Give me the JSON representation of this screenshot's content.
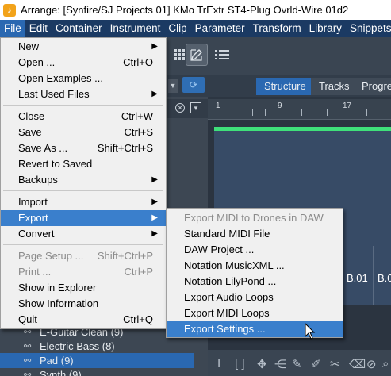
{
  "window": {
    "title": "Arrange: [Synfire/SJ Projects 01] KMo TrExtr ST4-Plug Ovrld-Wire 01d2",
    "app_icon": "synfire-app-icon"
  },
  "menubar": [
    "File",
    "Edit",
    "Container",
    "Instrument",
    "Clip",
    "Parameter",
    "Transform",
    "Library",
    "Snippets"
  ],
  "tabs": [
    "Structure",
    "Tracks",
    "Progres"
  ],
  "ruler": {
    "marks": [
      "1",
      "9",
      "17"
    ]
  },
  "clip_labels": [
    "B.01",
    "B.0"
  ],
  "tree": [
    {
      "label": "E-Guitar Clean (9)"
    },
    {
      "label": "Electric Bass (8)"
    },
    {
      "label": "Pad (9)"
    },
    {
      "label": "Synth (9)"
    }
  ],
  "file_menu": [
    {
      "label": "New",
      "shortcut": "",
      "submenu": true,
      "disabled": false
    },
    {
      "label": "Open ...",
      "shortcut": "Ctrl+O",
      "submenu": false,
      "disabled": false
    },
    {
      "label": "Open Examples ...",
      "shortcut": "",
      "submenu": false,
      "disabled": false
    },
    {
      "label": "Last Used Files",
      "shortcut": "",
      "submenu": true,
      "disabled": false
    },
    {
      "label": "Close",
      "shortcut": "Ctrl+W",
      "submenu": false,
      "disabled": false
    },
    {
      "label": "Save",
      "shortcut": "Ctrl+S",
      "submenu": false,
      "disabled": false
    },
    {
      "label": "Save As ...",
      "shortcut": "Shift+Ctrl+S",
      "submenu": false,
      "disabled": false
    },
    {
      "label": "Revert to Saved",
      "shortcut": "",
      "submenu": false,
      "disabled": false
    },
    {
      "label": "Backups",
      "shortcut": "",
      "submenu": true,
      "disabled": false
    },
    {
      "label": "Import",
      "shortcut": "",
      "submenu": true,
      "disabled": false
    },
    {
      "label": "Export",
      "shortcut": "",
      "submenu": true,
      "disabled": false
    },
    {
      "label": "Convert",
      "shortcut": "",
      "submenu": true,
      "disabled": false
    },
    {
      "label": "Page Setup ...",
      "shortcut": "Shift+Ctrl+P",
      "submenu": false,
      "disabled": true
    },
    {
      "label": "Print ...",
      "shortcut": "Ctrl+P",
      "submenu": false,
      "disabled": true
    },
    {
      "label": "Show in Explorer",
      "shortcut": "",
      "submenu": false,
      "disabled": false
    },
    {
      "label": "Show Information",
      "shortcut": "",
      "submenu": false,
      "disabled": false
    },
    {
      "label": "Quit",
      "shortcut": "Ctrl+Q",
      "submenu": false,
      "disabled": false
    }
  ],
  "export_menu": [
    {
      "label": "Export MIDI to Drones in DAW",
      "disabled": true
    },
    {
      "label": "Standard MIDI File",
      "disabled": false
    },
    {
      "label": "DAW Project ...",
      "disabled": false
    },
    {
      "label": "Notation MusicXML ...",
      "disabled": false
    },
    {
      "label": "Notation LilyPond ...",
      "disabled": false
    },
    {
      "label": "Export Audio Loops",
      "disabled": false
    },
    {
      "label": "Export MIDI Loops",
      "disabled": false
    },
    {
      "label": "Export Settings ...",
      "disabled": false
    }
  ],
  "colors": {
    "menubar_bg": "#1b3a63",
    "highlight": "#3a7fcc",
    "accent_green": "#3fe07a"
  }
}
